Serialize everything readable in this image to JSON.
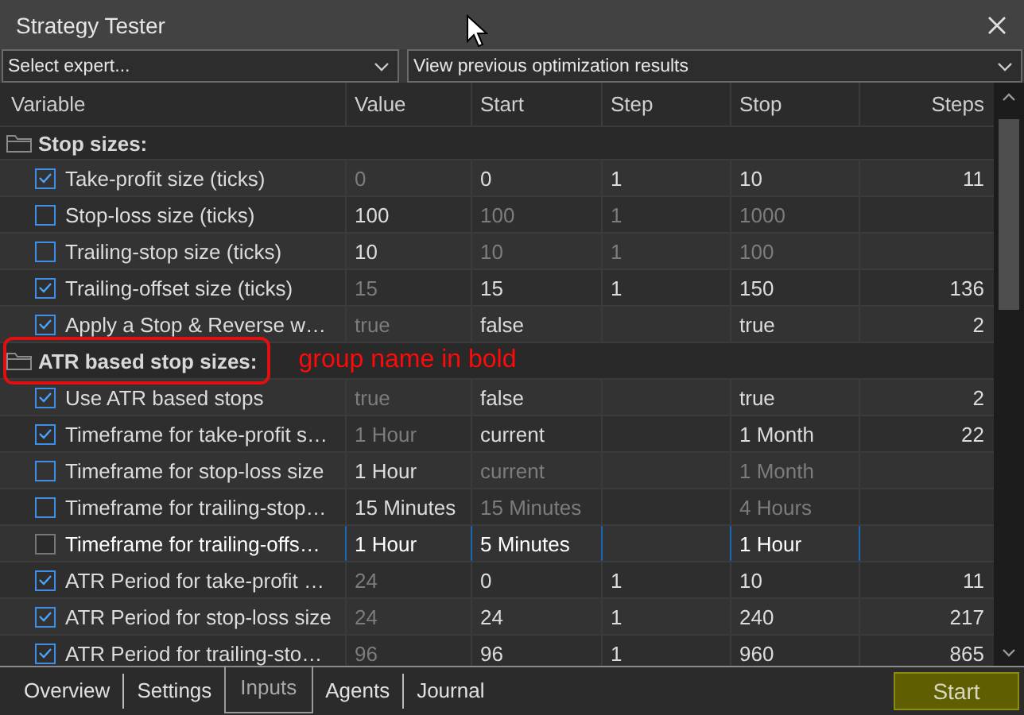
{
  "window": {
    "title": "Strategy Tester"
  },
  "selectors": [
    {
      "value": "Select expert..."
    },
    {
      "value": "View previous optimization results"
    }
  ],
  "table": {
    "columns": [
      "Variable",
      "Value",
      "Start",
      "Step",
      "Stop",
      "Steps"
    ],
    "rows": [
      {
        "kind": "group",
        "name": "Stop sizes:",
        "highlighted": false
      },
      {
        "kind": "param",
        "name": "Take-profit size (ticks)",
        "checked": true,
        "selected": false,
        "value": "0",
        "start": "0",
        "step": "1",
        "stop": "10",
        "steps": "11"
      },
      {
        "kind": "param",
        "name": "Stop-loss size (ticks)",
        "checked": false,
        "selected": false,
        "value": "100",
        "start": "100",
        "step": "1",
        "stop": "1000"
      },
      {
        "kind": "param",
        "name": "Trailing-stop size (ticks)",
        "checked": false,
        "selected": false,
        "value": "10",
        "start": "10",
        "step": "1",
        "stop": "100"
      },
      {
        "kind": "param",
        "name": "Trailing-offset size (ticks)",
        "checked": true,
        "selected": false,
        "value": "15",
        "start": "15",
        "step": "1",
        "stop": "150",
        "steps": "136"
      },
      {
        "kind": "param",
        "name": "Apply a Stop & Reverse w…",
        "checked": true,
        "selected": false,
        "value": "true",
        "start": "false",
        "stop": "true",
        "steps": "2"
      },
      {
        "kind": "group",
        "name": "ATR based stop sizes:",
        "highlighted": true,
        "note": "group name in bold"
      },
      {
        "kind": "param",
        "name": "Use ATR based stops",
        "checked": true,
        "selected": false,
        "value": "true",
        "start": "false",
        "stop": "true",
        "steps": "2"
      },
      {
        "kind": "param",
        "name": "Timeframe for take-profit s…",
        "checked": true,
        "selected": false,
        "value": "1 Hour",
        "start": "current",
        "stop": "1 Month",
        "steps": "22"
      },
      {
        "kind": "param",
        "name": "Timeframe for stop-loss size",
        "checked": false,
        "selected": false,
        "value": "1 Hour",
        "start": "current",
        "stop": "1 Month"
      },
      {
        "kind": "param",
        "name": "Timeframe for trailing-stop…",
        "checked": false,
        "selected": false,
        "value": "15 Minutes",
        "start": "15 Minutes",
        "stop": "4 Hours"
      },
      {
        "kind": "param",
        "name": "Timeframe for trailing-offs…",
        "checked": false,
        "selected": true,
        "value": "1 Hour",
        "start": "5 Minutes",
        "stop": "1 Hour"
      },
      {
        "kind": "param",
        "name": "ATR Period for take-profit …",
        "checked": true,
        "selected": false,
        "value": "24",
        "start": "0",
        "step": "1",
        "stop": "10",
        "steps": "11"
      },
      {
        "kind": "param",
        "name": "ATR Period for stop-loss size",
        "checked": true,
        "selected": false,
        "value": "24",
        "start": "24",
        "step": "1",
        "stop": "240",
        "steps": "217"
      },
      {
        "kind": "param",
        "name": "ATR Period for trailing-sto…",
        "checked": true,
        "selected": false,
        "value": "96",
        "start": "96",
        "step": "1",
        "stop": "960",
        "steps": "865"
      }
    ]
  },
  "tabs": [
    {
      "label": "Overview",
      "selected": false
    },
    {
      "label": "Settings",
      "selected": false
    },
    {
      "label": "Inputs",
      "selected": true
    },
    {
      "label": "Agents",
      "selected": false
    },
    {
      "label": "Journal",
      "selected": false
    }
  ],
  "start_button": {
    "label": "Start"
  }
}
